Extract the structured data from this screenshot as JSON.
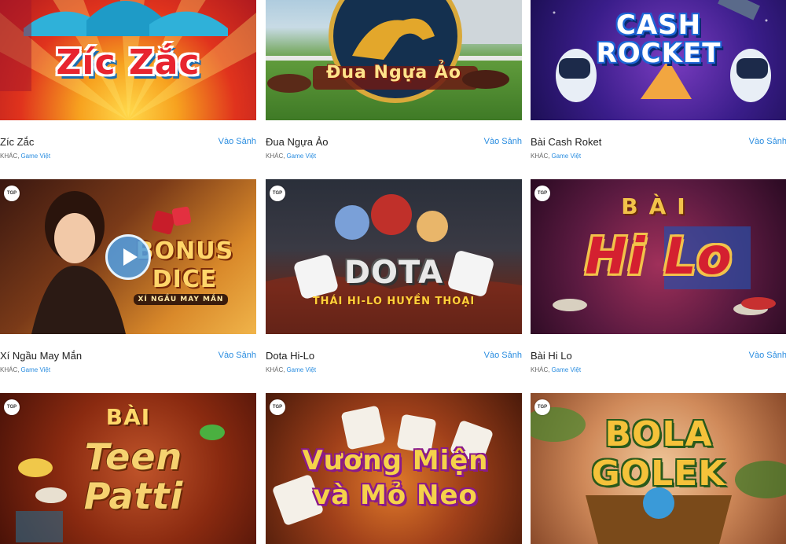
{
  "games": [
    {
      "title": "Zíc Zắc",
      "art_title": "Zíc Zắc",
      "enter_label": "Vào Sảnh",
      "category": "KHÁC,",
      "provider": "Game Việt"
    },
    {
      "title": "Đua Ngựa Ảo",
      "art_title": "Đua Ngựa Ảo",
      "enter_label": "Vào Sảnh",
      "category": "KHÁC,",
      "provider": "Game Việt"
    },
    {
      "title": "Bài Cash Roket",
      "art_title": "CASH ROCKET",
      "enter_label": "Vào Sảnh",
      "category": "KHÁC,",
      "provider": "Game Việt"
    },
    {
      "title": "Xí Ngầu May Mắn",
      "art_title": "BONUS DICE",
      "art_subtitle": "XÍ NGẦU MAY MẮN",
      "badge": "TGP",
      "enter_label": "Vào Sảnh",
      "category": "KHÁC,",
      "provider": "Game Việt"
    },
    {
      "title": "Dota Hi-Lo",
      "art_title": "DOTA",
      "art_subtitle": "THÁI HI-LO HUYỀN THOẠI",
      "badge": "TGP",
      "enter_label": "Vào Sảnh",
      "category": "KHÁC,",
      "provider": "Game Việt"
    },
    {
      "title": "Bài Hi Lo",
      "art_title": "Hi Lo",
      "art_subtitle": "BÀI",
      "badge": "TGP",
      "enter_label": "Vào Sảnh",
      "category": "KHÁC,",
      "provider": "Game Việt"
    },
    {
      "title": "",
      "art_title": "Teen Patti",
      "art_subtitle": "BÀI",
      "badge": "TGP"
    },
    {
      "title": "",
      "art_title": "Vương Miện và Mỏ Neo",
      "badge": "TGP"
    },
    {
      "title": "",
      "art_title": "BOLA GOLEK",
      "badge": "TGP"
    }
  ],
  "colors": {
    "link": "#2a8de0",
    "text": "#222222",
    "meta": "#666666"
  }
}
